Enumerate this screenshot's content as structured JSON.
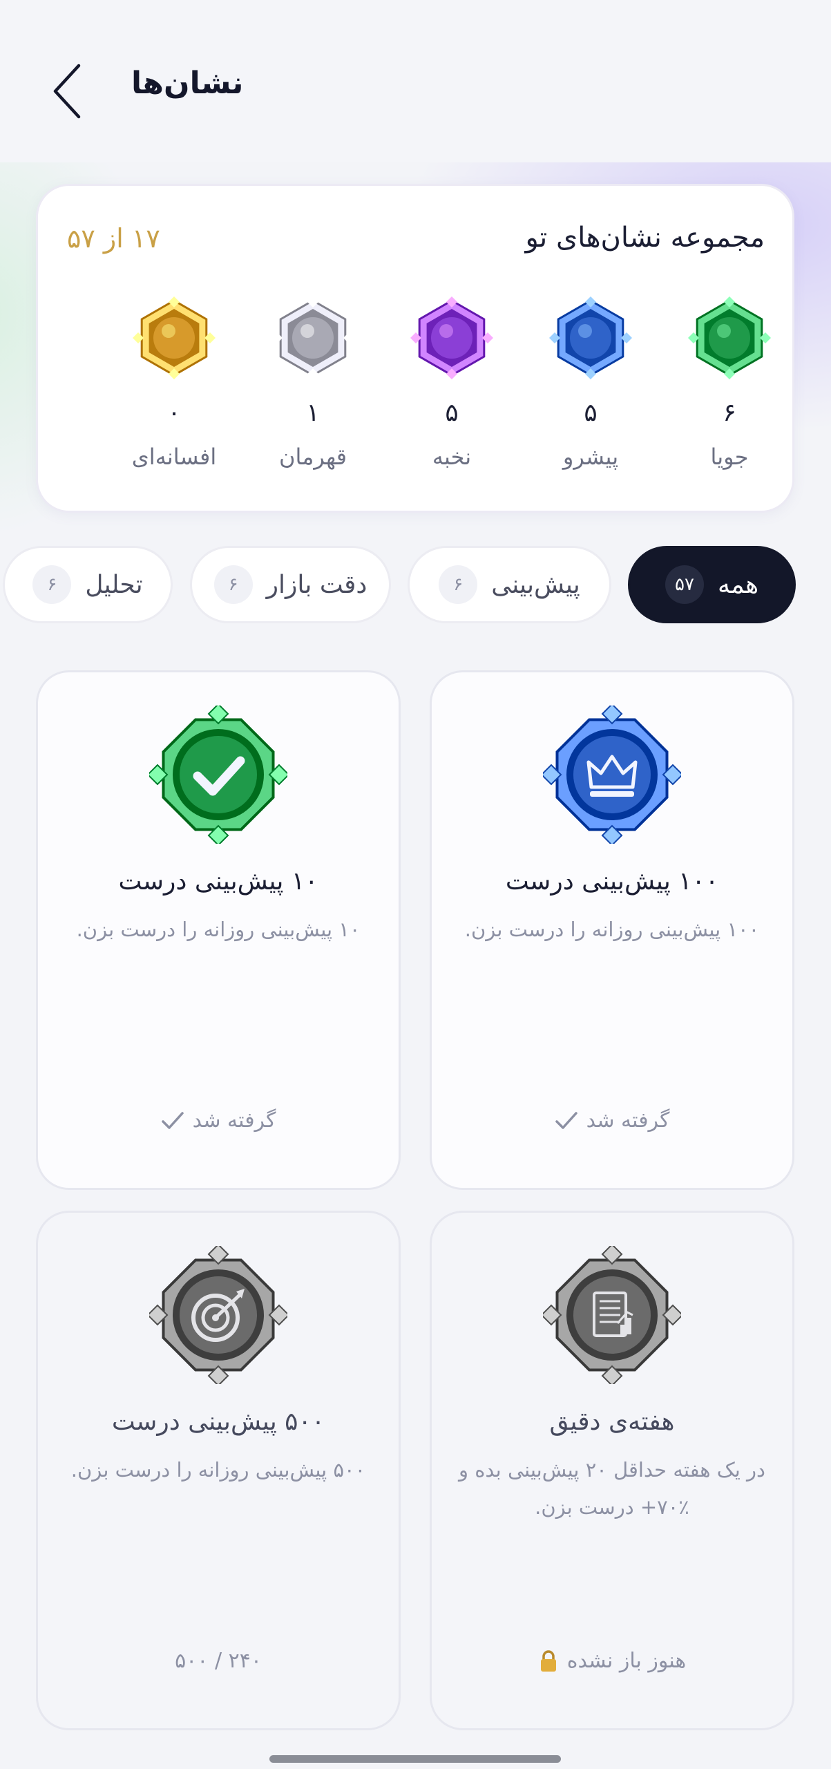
{
  "header": {
    "title": "نشان‌ها",
    "back_icon": "chevron-left-icon"
  },
  "summary": {
    "title": "مجموعه نشان‌های تو",
    "count_text": "۱۷ از ۵۷",
    "count_color": "#c9a046",
    "tiers": [
      {
        "name": "جویا",
        "count": "۶",
        "color": "#1f9a4a"
      },
      {
        "name": "پیشرو",
        "count": "۵",
        "color": "#2f63c9"
      },
      {
        "name": "نخبه",
        "count": "۵",
        "color": "#8b3fd6"
      },
      {
        "name": "قهرمان",
        "count": "۱",
        "color": "#a9a9b4"
      },
      {
        "name": "افسانه‌ای",
        "count": "۰",
        "color": "#d79a2b"
      }
    ]
  },
  "filters": [
    {
      "label": "همه",
      "count": "۵۷",
      "active": true
    },
    {
      "label": "پیش‌بینی",
      "count": "۶",
      "active": false
    },
    {
      "label": "دقت بازار",
      "count": "۶",
      "active": false
    },
    {
      "label": "تحلیل",
      "count": "۶",
      "active": false
    }
  ],
  "badges": [
    {
      "title": "۱۰۰ پیش‌بینی درست",
      "desc": "۱۰۰ پیش‌بینی روزانه را درست بزن.",
      "status": "گرفته شد",
      "status_icon": "checkmark-icon",
      "icon": "crown-icon",
      "tier_color": "#2f63c9"
    },
    {
      "title": "۱۰ پیش‌بینی درست",
      "desc": "۱۰ پیش‌بینی روزانه را درست بزن.",
      "status": "گرفته شد",
      "status_icon": "checkmark-icon",
      "icon": "checkmark-icon",
      "tier_color": "#1f9a4a"
    },
    {
      "title": "هفته‌ی دقیق",
      "desc": "در یک هفته حداقل ۲۰ پیش‌بینی بده و ٪۷۰+ درست بزن.",
      "status": "هنوز باز نشده",
      "status_icon": "lock-icon",
      "icon": "report-chart-icon",
      "tier_color": "#6b6b6b"
    },
    {
      "title": "۵۰۰ پیش‌بینی درست",
      "desc": "۵۰۰ پیش‌بینی روزانه را درست بزن.",
      "status": "۲۴۰ / ۵۰۰",
      "status_icon": "",
      "icon": "target-icon",
      "tier_color": "#6b6b6b"
    }
  ]
}
